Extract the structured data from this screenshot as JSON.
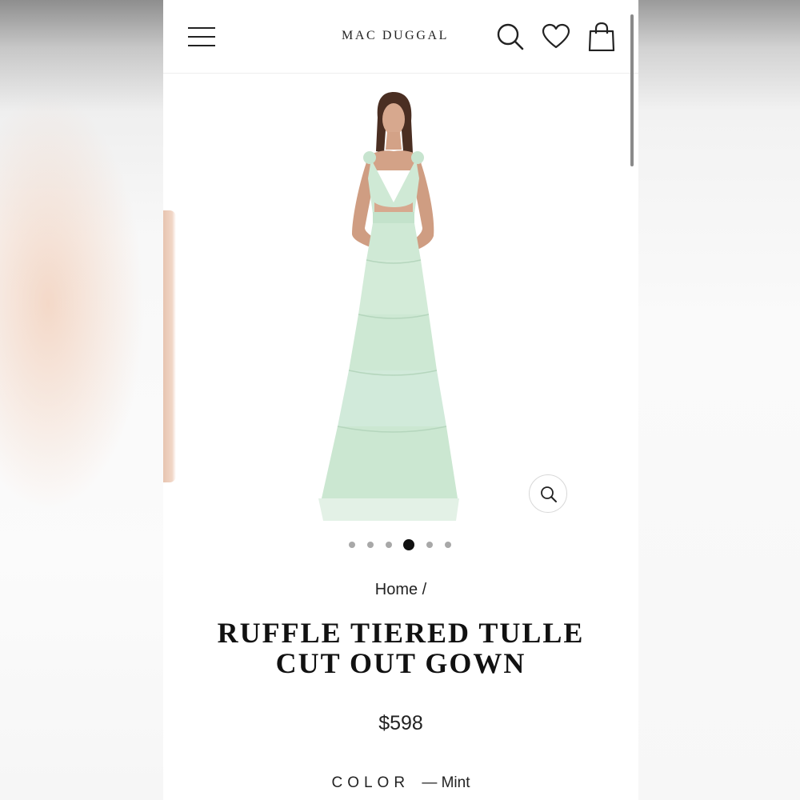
{
  "header": {
    "brand": "MAC DUGGAL",
    "icons": [
      "menu-icon",
      "search-icon",
      "heart-icon",
      "shopping-bag-icon"
    ]
  },
  "gallery": {
    "slide_count": 6,
    "active_slide": 4,
    "dress_color": "#cfe9d5",
    "zoom_icon": "zoom-icon"
  },
  "breadcrumb": {
    "home": "Home",
    "separator": "/"
  },
  "product": {
    "title_line1": "RUFFLE TIERED TULLE",
    "title_line2": "CUT OUT GOWN",
    "price": "$598",
    "color_label": "COLOR",
    "color_value": "— Mint"
  }
}
